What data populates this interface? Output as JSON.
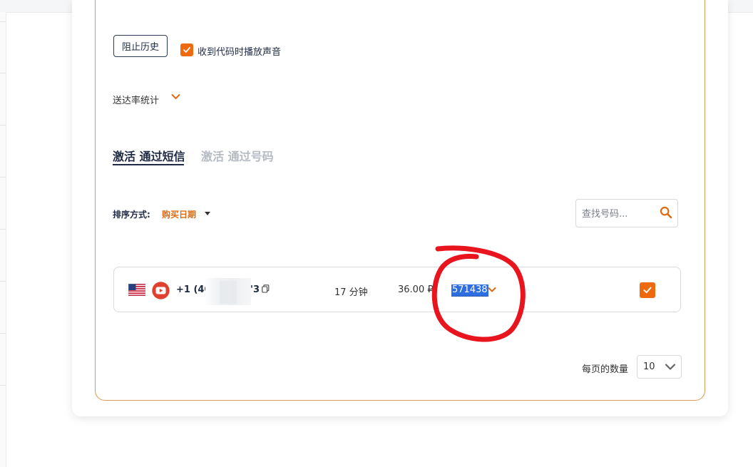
{
  "controls": {
    "block_history_label": "阻止历史",
    "sound_on_code_label": "收到代码时播放声音",
    "sound_on_code_checked": true,
    "delivery_stats_label": "送达率统计"
  },
  "tabs": [
    {
      "label": "激活 通过短信",
      "active": true
    },
    {
      "label": "激活 通过号码",
      "active": false
    }
  ],
  "sort": {
    "label": "排序方式:",
    "value": "购买日期"
  },
  "search": {
    "placeholder": "查找号码...",
    "value": ""
  },
  "activation": {
    "phone_prefix": "+1 (40",
    "phone_suffix": "'3",
    "time_left": "17 分钟",
    "price": "36.00 ₽",
    "code": "571438",
    "selected": true
  },
  "pagination": {
    "per_page_label": "每页的数量",
    "per_page_value": "10"
  },
  "colors": {
    "accent": "#ee6a0f",
    "navy": "#1f2a44",
    "panel_border": "#d99a55",
    "highlight": "#2d6fe0",
    "annotation": "#e8141e"
  }
}
